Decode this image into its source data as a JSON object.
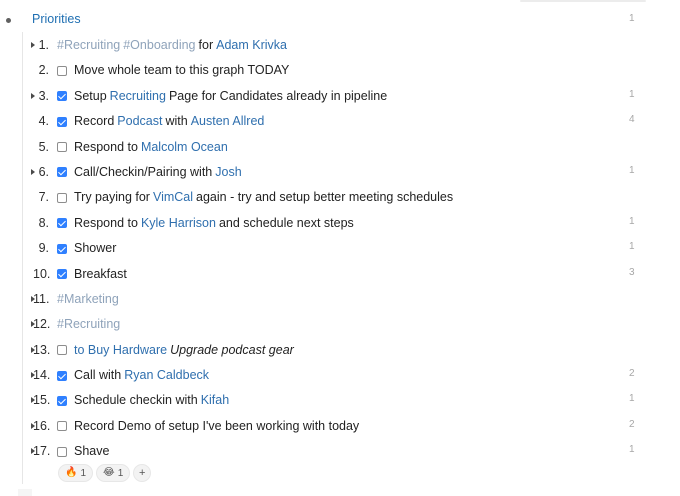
{
  "root": {
    "title": "Priorities",
    "count": "1"
  },
  "items": [
    {
      "number": "1.",
      "caret": true,
      "checkbox": null,
      "count": "",
      "parts": [
        {
          "text": "#Recruiting",
          "style": "tag"
        },
        {
          "text": "#Onboarding",
          "style": "tag"
        },
        {
          "text": "for",
          "style": "plain"
        },
        {
          "text": "Adam Krivka",
          "style": "link"
        }
      ]
    },
    {
      "number": "2.",
      "caret": false,
      "checkbox": "unchecked",
      "count": "",
      "parts": [
        {
          "text": "Move whole team to this graph TODAY",
          "style": "plain"
        }
      ]
    },
    {
      "number": "3.",
      "caret": true,
      "checkbox": "checked",
      "count": "1",
      "parts": [
        {
          "text": "Setup",
          "style": "plain"
        },
        {
          "text": "Recruiting",
          "style": "link"
        },
        {
          "text": "Page for Candidates already in pipeline",
          "style": "plain"
        }
      ]
    },
    {
      "number": "4.",
      "caret": false,
      "checkbox": "checked",
      "count": "4",
      "parts": [
        {
          "text": "Record",
          "style": "plain"
        },
        {
          "text": "Podcast",
          "style": "link"
        },
        {
          "text": "with",
          "style": "plain"
        },
        {
          "text": "Austen Allred",
          "style": "link"
        }
      ]
    },
    {
      "number": "5.",
      "caret": false,
      "checkbox": "unchecked",
      "count": "",
      "parts": [
        {
          "text": "Respond to",
          "style": "plain"
        },
        {
          "text": "Malcolm Ocean",
          "style": "link"
        }
      ]
    },
    {
      "number": "6.",
      "caret": true,
      "checkbox": "checked",
      "count": "1",
      "parts": [
        {
          "text": "Call/Checkin/Pairing with",
          "style": "plain"
        },
        {
          "text": "Josh",
          "style": "link"
        }
      ]
    },
    {
      "number": "7.",
      "caret": false,
      "checkbox": "unchecked",
      "count": "",
      "parts": [
        {
          "text": "Try paying for",
          "style": "plain"
        },
        {
          "text": "VimCal",
          "style": "link"
        },
        {
          "text": "again - try and setup better meeting schedules",
          "style": "plain"
        }
      ]
    },
    {
      "number": "8.",
      "caret": false,
      "checkbox": "checked",
      "count": "1",
      "parts": [
        {
          "text": "Respond to",
          "style": "plain"
        },
        {
          "text": "Kyle Harrison",
          "style": "link"
        },
        {
          "text": "and schedule next steps",
          "style": "plain"
        }
      ]
    },
    {
      "number": "9.",
      "caret": false,
      "checkbox": "checked",
      "count": "1",
      "parts": [
        {
          "text": "Shower",
          "style": "plain"
        }
      ]
    },
    {
      "number": "10.",
      "caret": false,
      "checkbox": "checked",
      "count": "3",
      "parts": [
        {
          "text": "Breakfast",
          "style": "plain"
        }
      ]
    },
    {
      "number": "11.",
      "caret": true,
      "checkbox": null,
      "count": "",
      "parts": [
        {
          "text": "#Marketing",
          "style": "tag"
        }
      ]
    },
    {
      "number": "12.",
      "caret": true,
      "checkbox": null,
      "count": "",
      "parts": [
        {
          "text": "#Recruiting",
          "style": "tag"
        }
      ]
    },
    {
      "number": "13.",
      "caret": true,
      "checkbox": "unchecked",
      "count": "",
      "parts": [
        {
          "text": "to Buy Hardware",
          "style": "link"
        },
        {
          "text": "Upgrade podcast gear",
          "style": "em"
        }
      ]
    },
    {
      "number": "14.",
      "caret": true,
      "checkbox": "checked",
      "count": "2",
      "parts": [
        {
          "text": "Call with",
          "style": "plain"
        },
        {
          "text": "Ryan Caldbeck",
          "style": "link"
        }
      ]
    },
    {
      "number": "15.",
      "caret": true,
      "checkbox": "checked",
      "count": "1",
      "parts": [
        {
          "text": "Schedule checkin with",
          "style": "plain"
        },
        {
          "text": "Kifah",
          "style": "link"
        }
      ]
    },
    {
      "number": "16.",
      "caret": true,
      "checkbox": "unchecked",
      "count": "2",
      "parts": [
        {
          "text": "Record Demo of setup I've been working with today",
          "style": "plain"
        }
      ]
    },
    {
      "number": "17.",
      "caret": true,
      "checkbox": "unchecked",
      "count": "1",
      "parts": [
        {
          "text": "Shave",
          "style": "plain"
        }
      ]
    }
  ],
  "reactions": [
    {
      "emoji": "🔥",
      "count": "1",
      "icon": "fire-icon"
    },
    {
      "emoji": "😂",
      "count": "1",
      "icon": "laughing-face-icon"
    }
  ],
  "reaction_add_label": "+"
}
